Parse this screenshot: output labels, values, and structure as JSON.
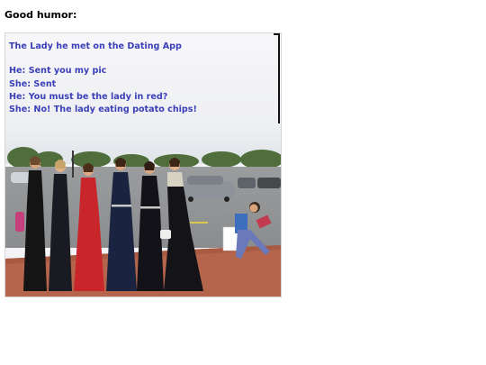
{
  "post": {
    "heading": "Good humor:"
  },
  "meme": {
    "title": "The Lady he met on the Dating App",
    "dialogue": [
      "He:  Sent you my pic",
      "She: Sent",
      "He:  You must be the lady in red?",
      "She: No!  The lady eating potato chips!"
    ]
  },
  "colors": {
    "caption_text": "#3a3fb8",
    "red_dress": "#c8262b",
    "navy_dress": "#1a2340"
  }
}
